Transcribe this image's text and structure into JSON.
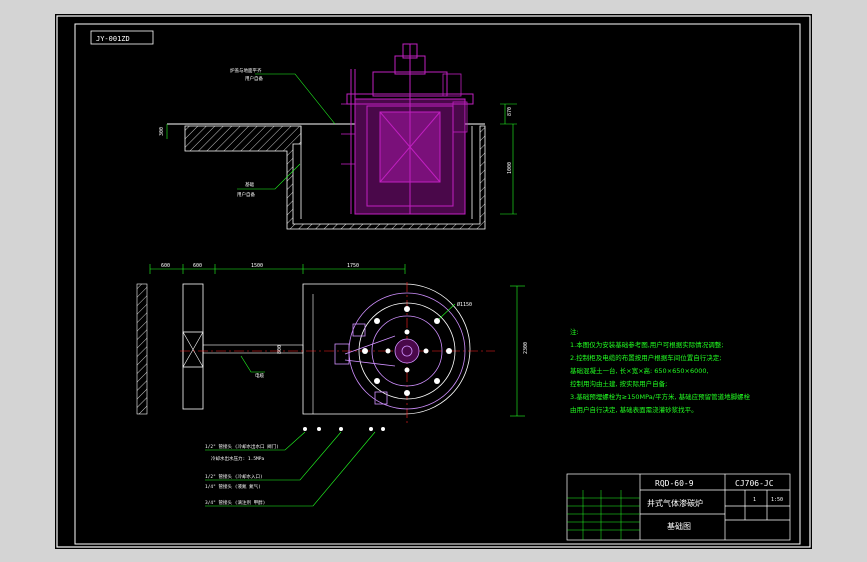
{
  "drawing": {
    "code_box": "JY-001ZD",
    "dimensions": [
      "300",
      "870",
      "1000",
      "600",
      "600",
      "1500",
      "1750",
      "2300",
      "800",
      "Ø1150"
    ],
    "notes_title": "注:",
    "notes": [
      "1.本图仅为安装基础参考图,用户可根据实际情况调整;",
      "2.控制柜及电缆的布置按用户根据车间位置自行决定;",
      "  基础混凝土一台, 长×宽×高: 650×650×6000,",
      "  控制用沟由土建, 按实际用户自备;",
      "3.基础预埋螺栓为≥150MPa/平方米, 基础应预留管道地脚螺栓",
      "  由用户自行决定, 基础表面需浇灌砂浆找平。"
    ],
    "callouts": [
      "1/2\" 管接头 (冷却水出水口 阀门)",
      "冷却水出水压力: 1.5MPa",
      "1/2\" 管接头 (冷却水入口)",
      "1/4\" 管接头 (液氮 氮气)",
      "3/4\" 管接头 (滴注剂 甲醇)"
    ],
    "side_labels": [
      "炉盖与地面平齐",
      "用户自备",
      "基础",
      "用户自备",
      "电缆"
    ],
    "title_block": {
      "model": "RQD-60-9",
      "drawing_no": "CJ706-JC",
      "name": "井式气体渗碳炉",
      "sheet_type": "基础图",
      "scale": "1:50",
      "qty": "1"
    }
  },
  "colors": {
    "paper": "#000000",
    "frame": "#ffffff",
    "furnace": "#c020c0",
    "annotation": "#22ff22",
    "centerline": "#ff2020",
    "cyan": "#20e0e0"
  }
}
